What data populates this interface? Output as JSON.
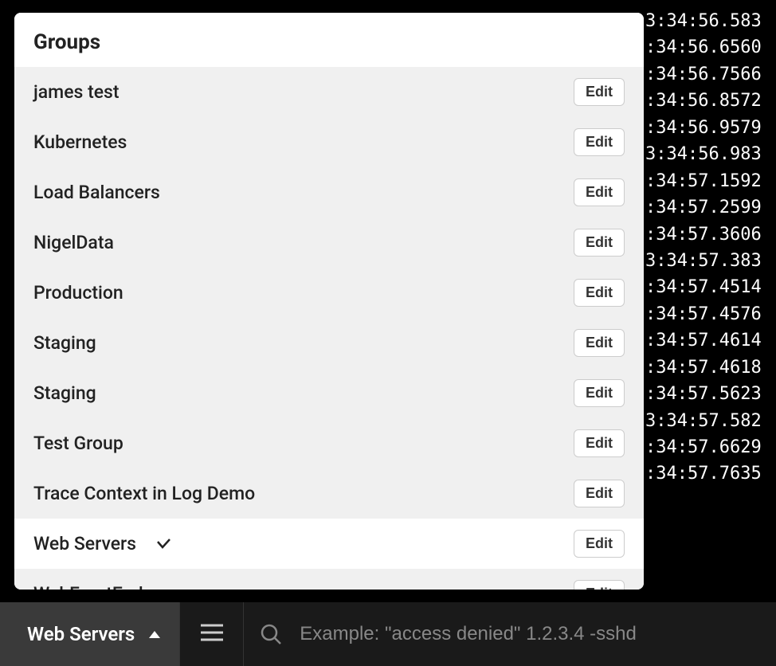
{
  "dropdown": {
    "header": "Groups",
    "edit_label": "Edit",
    "items": [
      {
        "label": "james test",
        "selected": false
      },
      {
        "label": "Kubernetes",
        "selected": false
      },
      {
        "label": "Load Balancers",
        "selected": false
      },
      {
        "label": "NigelData",
        "selected": false
      },
      {
        "label": "Production",
        "selected": false
      },
      {
        "label": "Staging",
        "selected": false
      },
      {
        "label": "Staging",
        "selected": false
      },
      {
        "label": "Test Group",
        "selected": false
      },
      {
        "label": "Trace Context in Log Demo",
        "selected": false
      },
      {
        "label": "Web Servers",
        "selected": true
      },
      {
        "label": "WebFrontEnd",
        "selected": false
      }
    ]
  },
  "bottom_bar": {
    "selected_group": "Web Servers",
    "search_placeholder": "Example: \"access denied\" 1.2.3.4 -sshd"
  },
  "logs": [
    "3:34:56.583",
    ":34:56.6560",
    ":34:56.7566",
    ":34:56.8572",
    ":34:56.9579",
    "3:34:56.983",
    ":34:57.1592",
    ":34:57.2599",
    ":34:57.3606",
    "3:34:57.383",
    ":34:57.4514",
    ":34:57.4576",
    ":34:57.4614",
    ":34:57.4618",
    ":34:57.5623",
    "3:34:57.582",
    ":34:57.6629",
    ":34:57.7635"
  ]
}
